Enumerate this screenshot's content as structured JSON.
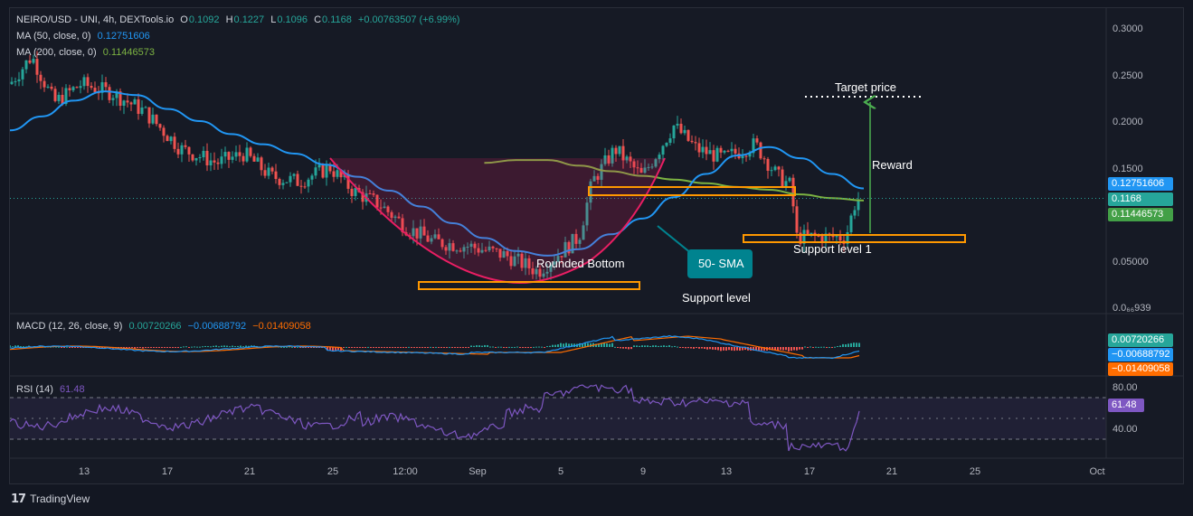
{
  "header": {
    "symbol": "NEIRO/USD - UNI, 4h, DEXTools.io",
    "ohlc": [
      {
        "k": "O",
        "v": "0.1092"
      },
      {
        "k": "H",
        "v": "0.1227"
      },
      {
        "k": "L",
        "v": "0.1096"
      },
      {
        "k": "C",
        "v": "0.1168"
      }
    ],
    "change": "+0.00763507 (+6.99%)",
    "ma50_label": "MA (50, close, 0)",
    "ma50_value": "0.12751606",
    "ma200_label": "MA (200, close, 0)",
    "ma200_value": "0.11446573"
  },
  "price_axis": {
    "ticks": [
      "0.3000",
      "0.2500",
      "0.2000",
      "0.1500",
      "0.05000",
      "0.0₆₆939"
    ],
    "tag_ma50": "0.12751606",
    "tag_close": "0.1168",
    "tag_ma200": "0.11446573"
  },
  "macd": {
    "label": "MACD (12, 26, close, 9)",
    "hist": "0.00720266",
    "macd": "−0.00688792",
    "signal": "−0.01409058",
    "tag_hist": "0.00720266",
    "tag_macd": "−0.00688792",
    "tag_signal": "−0.01409058"
  },
  "rsi": {
    "label": "RSI (14)",
    "value": "61.48",
    "ticks": [
      "80.00",
      "40.00"
    ],
    "tag": "61.48"
  },
  "time_axis": [
    "13",
    "17",
    "21",
    "25",
    "12:00",
    "Sep",
    "5",
    "9",
    "13",
    "17",
    "21",
    "25",
    "Oct"
  ],
  "annotations": {
    "target_price": "Target price",
    "reward": "Reward",
    "rounded_bottom": "Rounded Bottom",
    "sma_callout": "50- SMA",
    "support_level": "Support level",
    "support_level_1": "Support level 1"
  },
  "footer": {
    "brand": "TradingView"
  },
  "colors": {
    "bg": "#161a25",
    "up": "#26a69a",
    "down": "#ef5350",
    "ma50": "#2196f3",
    "ma200": "#7cb342",
    "macd_signal": "#ff6d00",
    "rsi": "#7e57c2",
    "support": "#ff9800",
    "callout": "#00838f",
    "cup": "#e91e63",
    "arrow": "#4caf50"
  },
  "chart_data": {
    "type": "line",
    "title": "NEIRO/USD - UNI, 4h, DEXTools.io",
    "price_axis_ticks": [
      0.3,
      0.25,
      0.2,
      0.15,
      0.05
    ],
    "x_ticks": [
      "13",
      "17",
      "21",
      "25",
      "12:00",
      "Sep",
      "5",
      "9",
      "13",
      "17",
      "21",
      "25",
      "Oct"
    ],
    "series": [
      {
        "name": "MA (50, close, 0)",
        "values": [
          0.19,
          0.205,
          0.222,
          0.232,
          0.228,
          0.213,
          0.2,
          0.186,
          0.175,
          0.165,
          0.153,
          0.14,
          0.125,
          0.108,
          0.09,
          0.074,
          0.06,
          0.055,
          0.062,
          0.078,
          0.095,
          0.118,
          0.143,
          0.163,
          0.172,
          0.16,
          0.143,
          0.12751606
        ]
      },
      {
        "name": "MA (200, close, 0)",
        "values": [
          null,
          null,
          null,
          null,
          null,
          null,
          null,
          null,
          null,
          null,
          null,
          null,
          null,
          null,
          null,
          0.155,
          0.158,
          0.158,
          0.152,
          0.146,
          0.141,
          0.137,
          0.133,
          0.129,
          0.126,
          0.121,
          0.117,
          0.11446573
        ]
      }
    ],
    "close_price": 0.1168,
    "levels": [
      {
        "name": "Support level",
        "value": 0.032
      },
      {
        "name": "Support level 1",
        "value": 0.073
      },
      {
        "name": "Target price",
        "value": 0.224
      }
    ],
    "macd": {
      "hist": 0.00720266,
      "macd": -0.00688792,
      "signal": -0.01409058
    },
    "rsi": {
      "value": 61.48,
      "bands": [
        70,
        30
      ],
      "ticks": [
        80,
        40
      ]
    }
  }
}
